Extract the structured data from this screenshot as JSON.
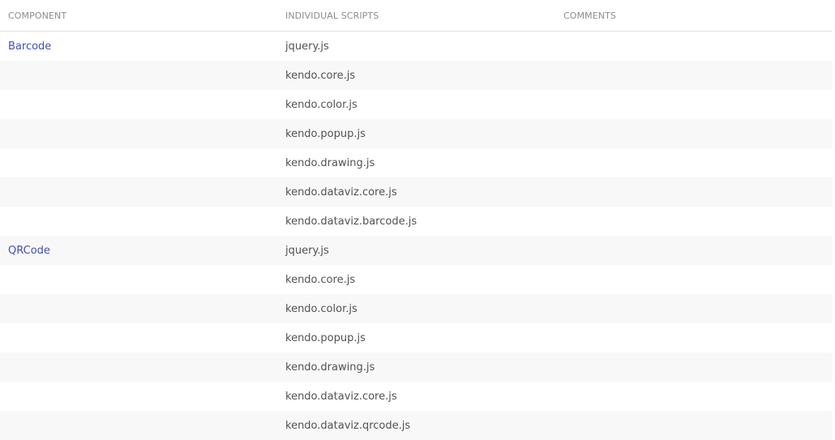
{
  "table": {
    "headers": [
      "COMPONENT",
      "INDIVIDUAL SCRIPTS",
      "COMMENTS"
    ],
    "rows": [
      {
        "component": "Barcode",
        "script": "jquery.js",
        "comment": ""
      },
      {
        "component": "",
        "script": "kendo.core.js",
        "comment": ""
      },
      {
        "component": "",
        "script": "kendo.color.js",
        "comment": ""
      },
      {
        "component": "",
        "script": "kendo.popup.js",
        "comment": ""
      },
      {
        "component": "",
        "script": "kendo.drawing.js",
        "comment": ""
      },
      {
        "component": "",
        "script": "kendo.dataviz.core.js",
        "comment": ""
      },
      {
        "component": "",
        "script": "kendo.dataviz.barcode.js",
        "comment": ""
      },
      {
        "component": "QRCode",
        "script": "jquery.js",
        "comment": ""
      },
      {
        "component": "",
        "script": "kendo.core.js",
        "comment": ""
      },
      {
        "component": "",
        "script": "kendo.color.js",
        "comment": ""
      },
      {
        "component": "",
        "script": "kendo.popup.js",
        "comment": ""
      },
      {
        "component": "",
        "script": "kendo.drawing.js",
        "comment": ""
      },
      {
        "component": "",
        "script": "kendo.dataviz.core.js",
        "comment": ""
      },
      {
        "component": "",
        "script": "kendo.dataviz.qrcode.js",
        "comment": ""
      }
    ]
  },
  "colors": {
    "link": "#3f51b5",
    "header_text": "#8c8c8c",
    "row_stripe": "#f8f8f8"
  }
}
